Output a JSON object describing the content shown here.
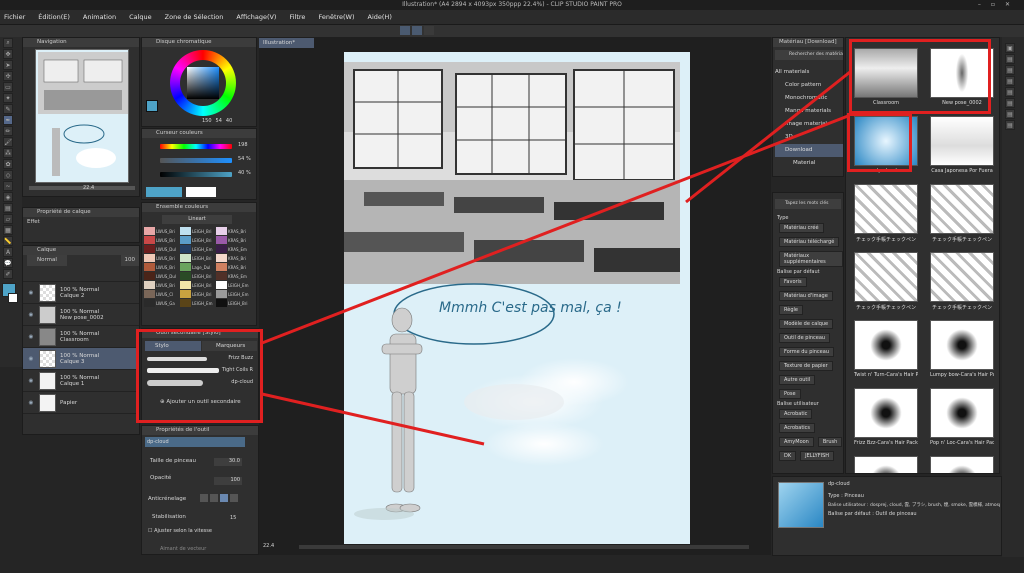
{
  "titlebar": {
    "title": "Illustration* (A4 2894 x 4093px 350ppp 22.4%) - CLIP STUDIO PAINT PRO"
  },
  "menu": [
    "Fichier",
    "Édition(E)",
    "Animation",
    "Calque",
    "Zone de Sélection",
    "Affichage(V)",
    "Filtre",
    "Fenêtre(W)",
    "Aide(H)"
  ],
  "navigator": {
    "title": "Navigation",
    "zoom": "22.4"
  },
  "color_wheel": {
    "title": "Disque chromatique",
    "h": "150",
    "s": "54",
    "v": "40"
  },
  "color_slider": {
    "title": "Curseur couleurs",
    "h": "198",
    "s": "54 %",
    "v": "40 %"
  },
  "color_set": {
    "title": "Ensemble couleurs",
    "selector": "Lineart",
    "names": [
      "LWUS_Bri",
      "LWUS_Bri",
      "LWUS_Dul",
      "LWUS_Bri",
      "LWUS_Bri",
      "LWUS_Dul",
      "LWUS_Bri",
      "LWUS_Cl",
      "LWUS_Ga"
    ],
    "names2": [
      "LEIGH_Bri",
      "LEIGH_Bri",
      "LEIGH_Em",
      "LEIGH_Bri",
      "Lage_Dul",
      "LEIGH_Bri",
      "LEIGH_Bri",
      "LEIGH_Bri",
      "LEIGH_Em"
    ],
    "names3": [
      "KRAS_Bri",
      "KRAS_Bri",
      "KRAS_Em",
      "KRAS_Bri",
      "KRAS_Bri",
      "KRAS_Em",
      "LEIGH_Em",
      "LEIGH_Em",
      "LEIGH_Bri"
    ]
  },
  "layer_props": {
    "title": "Propriété de calque",
    "effect": "Effet"
  },
  "layers": {
    "title": "Calque",
    "blend": "Normal",
    "opacity": "100",
    "items": [
      {
        "mode": "100 % Normal",
        "name": "Calque 2"
      },
      {
        "mode": "100 % Normal",
        "name": "New pose_0002"
      },
      {
        "mode": "100 % Normal",
        "name": "Classroom"
      },
      {
        "mode": "100 % Normal",
        "name": "Calque 3"
      },
      {
        "mode": "100 % Normal",
        "name": "Calque 1"
      },
      {
        "mode": "",
        "name": "Papier"
      }
    ]
  },
  "subtool": {
    "title": "Outil secondaire [Stylo]",
    "tab_pen": "Stylo",
    "tab_marker": "Marqueurs",
    "brushes": [
      "Frizz Buzz",
      "Tight Coils R",
      "dp-cloud"
    ],
    "add": "Ajouter un outil secondaire"
  },
  "tool_props": {
    "title": "Propriétés de l'outil",
    "tool": "dp-cloud",
    "brush_size_label": "Taille de pinceau",
    "brush_size": "30.0",
    "opacity_label": "Opacité",
    "opacity": "100",
    "aa_label": "Anticrénelage",
    "stab_label": "Stabilisation",
    "stab": "15",
    "speed_label": "Ajuster selon la vitesse",
    "vector_label": "Aimant de vecteur"
  },
  "canvas": {
    "tab": "Illustration*",
    "zoom": "22.4",
    "speech": "Mmmh C'est pas mal, ça !"
  },
  "materials": {
    "title": "Matériau [Download]",
    "search": "Rechercher des matériaux",
    "tree": [
      "All materials",
      "Color pattern",
      "Monochromatic",
      "Manga materials",
      "Image material",
      "3D",
      "Download",
      "Material"
    ],
    "tag_search": "Tapez les mots clés",
    "type_label": "Type",
    "type_tags": [
      "Matériau créé",
      "Matériau téléchargé",
      "Matériaux supplémentaires"
    ],
    "default_label": "Balise par défaut",
    "default_tags": [
      "Favoris",
      "Matériau d'image",
      "Règle",
      "Modèle de calque",
      "Outil de pinceau",
      "Forme du pinceau",
      "Texture de papier",
      "Autre outil",
      "Pose"
    ],
    "user_label": "Balise utilisateur",
    "user_tags": [
      "Acrobatic",
      "Acrobatics",
      "AmyMoon",
      "Brush",
      "DK",
      "JELLYFISH"
    ],
    "items": [
      "Classroom",
      "New pose_0002",
      "dp-cloud",
      "Casa Japonesa Por Fuera",
      "チェック手帳チェックペン",
      "チェック手帳チェックペン",
      "チェック手帳チェックペン",
      "チェック手帳チェックペン",
      "Twist n' Turn-Cara's Hair Pack",
      "Lumpy bow-Cara's Hair Pack",
      "Frizz Bzz-Cara's Hair Pack",
      "Pop n' Loc-Cara's Hair Pack",
      "",
      ""
    ],
    "detail": {
      "name": "dp-cloud",
      "type": "Type : Pinceau",
      "user_tags": "Balise utilisateur : dosprej, cloud, 雲, ブラシ, brush, 煙, smoke, 雲模様, atmosphere",
      "default_tags": "Balise par défaut : Outil de pinceau"
    }
  },
  "colors": {
    "accent": "#e02020",
    "panel": "#2f2f2f",
    "canvas_bg": "#ddf0f8"
  }
}
